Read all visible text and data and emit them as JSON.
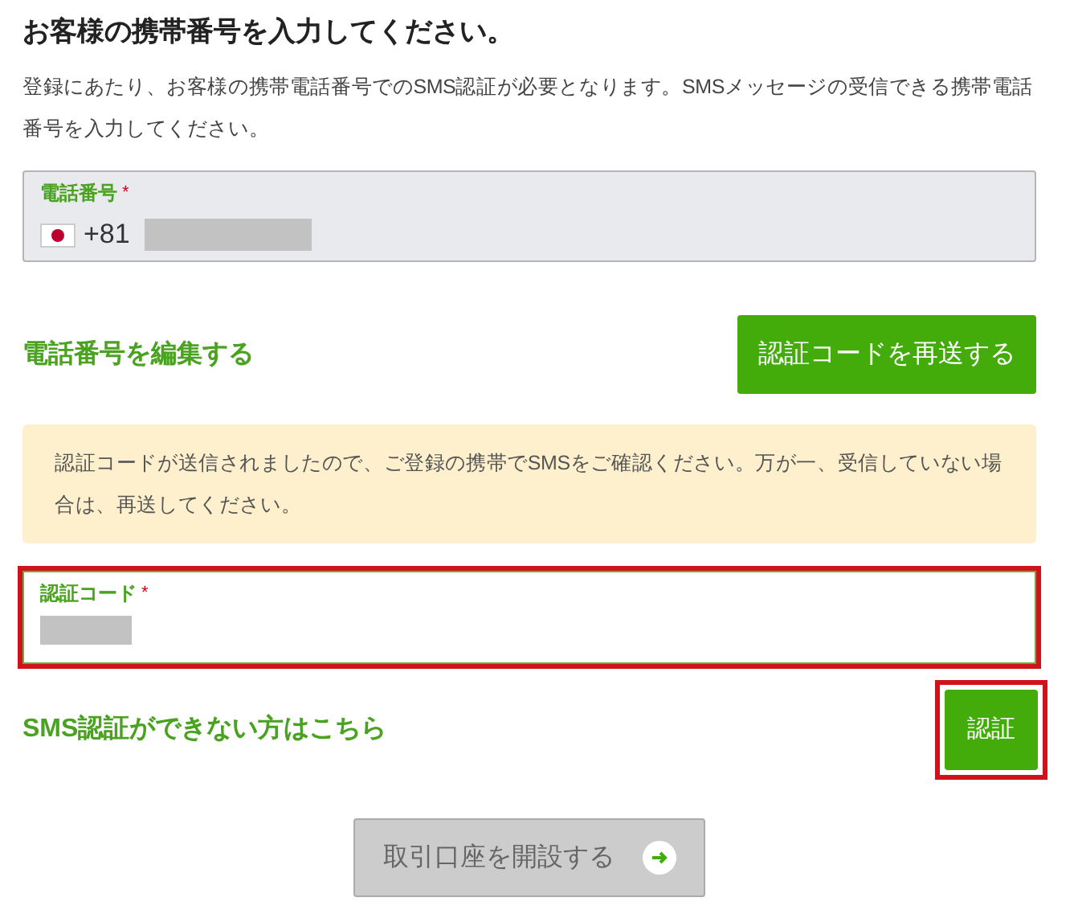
{
  "heading": "お客様の携帯番号を入力してください。",
  "description": "登録にあたり、お客様の携帯電話番号でのSMS認証が必要となります。SMSメッセージの受信できる携帯電話番号を入力してください。",
  "phone_field": {
    "label": "電話番号",
    "required_mark": "*",
    "country_code": "+81",
    "disabled": true,
    "value_redacted": true
  },
  "edit_phone_link": "電話番号を編集する",
  "resend_button": "認証コードを再送する",
  "notice": "認証コードが送信されましたので、ご登録の携帯でSMSをご確認ください。万が一、受信していない場合は、再送してください。",
  "code_field": {
    "label": "認証コード",
    "required_mark": "*",
    "value_redacted": true,
    "highlighted": true
  },
  "sms_help_link": "SMS認証ができない方はこちら",
  "verify_button": {
    "label": "認証",
    "highlighted": true
  },
  "open_account_button": {
    "label": "取引口座を開設する",
    "disabled": true
  }
}
